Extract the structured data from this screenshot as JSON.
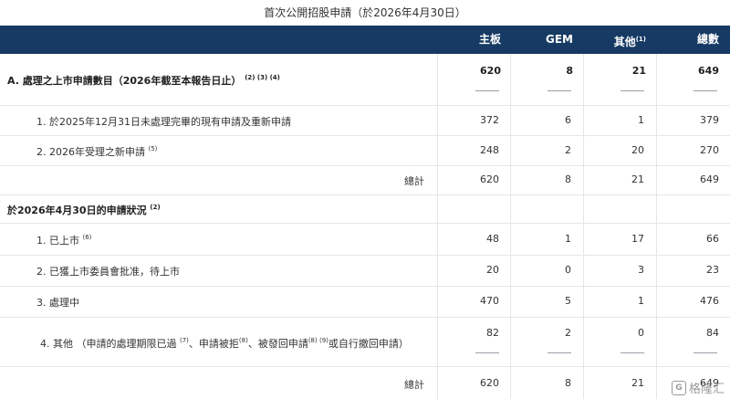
{
  "title": "首次公開招股申請（於2026年4月30日）",
  "headers": {
    "main_board": "主板",
    "gem": "GEM",
    "others": "其他",
    "others_sup": "(1)",
    "total": "總數"
  },
  "section_a": {
    "label": "A. 處理之上市申請數目（2026年截至本報告日止）",
    "sup": "(2) (3) (4)",
    "values": [
      "620",
      "8",
      "21",
      "649"
    ]
  },
  "rows_a": [
    {
      "label": "1. 於2025年12月31日未處理完畢的現有申請及重新申請",
      "sup": "",
      "values": [
        "372",
        "6",
        "1",
        "379"
      ]
    },
    {
      "label": "2. 2026年受理之新申請",
      "sup": "(5)",
      "values": [
        "248",
        "2",
        "20",
        "270"
      ]
    }
  ],
  "total_a": {
    "label": "總計",
    "values": [
      "620",
      "8",
      "21",
      "649"
    ]
  },
  "section_b": {
    "label": "於2026年4月30日的申請狀況",
    "sup": "(2)"
  },
  "rows_b": [
    {
      "label": "1. 已上市",
      "sup": "(6)",
      "values": [
        "48",
        "1",
        "17",
        "66"
      ]
    },
    {
      "label": "2. 已獲上市委員會批准，待上市",
      "sup": "",
      "values": [
        "20",
        "0",
        "3",
        "23"
      ]
    },
    {
      "label": "3. 處理中",
      "sup": "",
      "values": [
        "470",
        "5",
        "1",
        "476"
      ]
    }
  ],
  "row_b4": {
    "parts": [
      "4. 其他 （申請的處理期限已過 ",
      "(7)",
      "、申請被拒",
      "(8)",
      "、被發回申請",
      "(8) (9)",
      "或自行撤回申請）"
    ],
    "values": [
      "82",
      "2",
      "0",
      "84"
    ]
  },
  "total_b": {
    "label": "總計",
    "values": [
      "620",
      "8",
      "21",
      "649"
    ]
  },
  "watermark": {
    "logo": "G",
    "text": "格隆汇"
  },
  "colors": {
    "header_bg": "#163a63",
    "header_text": "#ffffff",
    "grid": "#e6e6e6"
  }
}
